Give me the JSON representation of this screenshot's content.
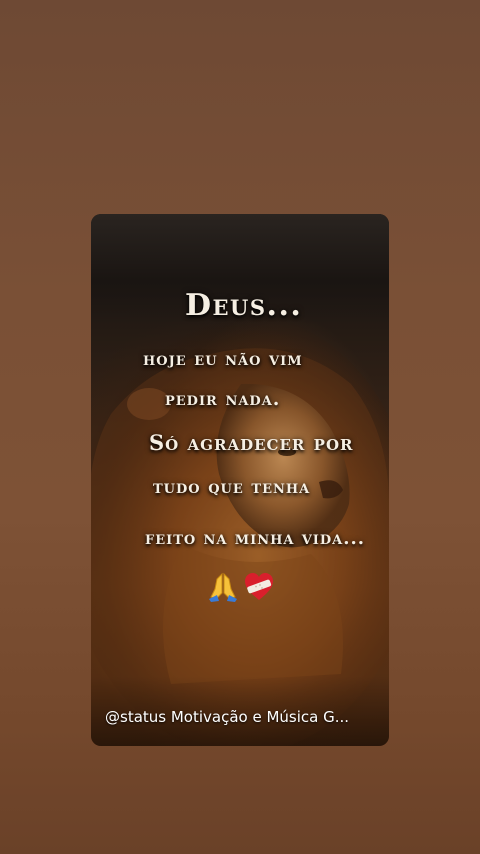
{
  "post": {
    "quote_lines": [
      "Deus...",
      "hoje eu não vim",
      "pedir nada.",
      "Só agradecer por",
      "tudo que tenha",
      "feito na minha vida..."
    ],
    "emojis": [
      "praying-hands",
      "heart-with-bandage"
    ],
    "emoji_chars": [
      "🙏",
      "❤️‍🩹"
    ],
    "credit": "@status Motivação e Música G..."
  },
  "colors": {
    "background": "#7a5036",
    "text": "#f6efe3"
  }
}
